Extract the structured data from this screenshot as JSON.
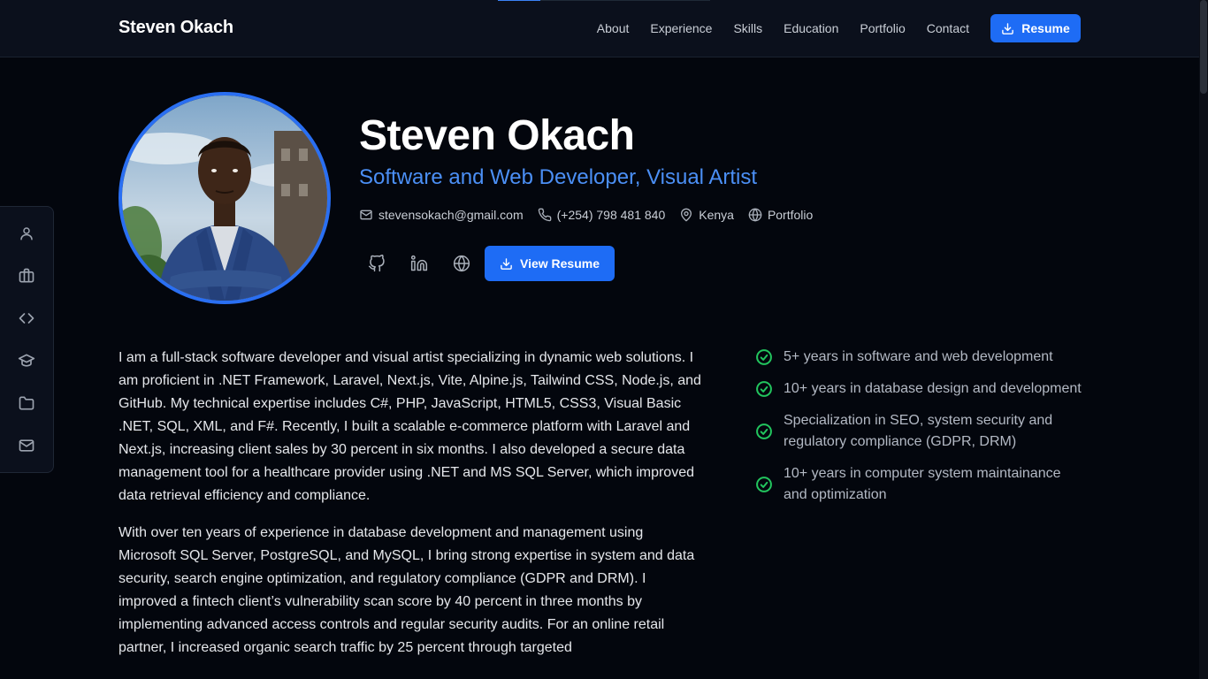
{
  "navbar": {
    "brand": "Steven Okach",
    "links": [
      "About",
      "Experience",
      "Skills",
      "Education",
      "Portfolio",
      "Contact"
    ],
    "resume_label": "Resume",
    "scroll_progress": 0.2
  },
  "side_nav": {
    "icons": [
      "user-icon",
      "briefcase-icon",
      "code-icon",
      "graduation-cap-icon",
      "folder-icon",
      "mail-icon"
    ]
  },
  "hero": {
    "name": "Steven Okach",
    "title": "Software and Web Developer, Visual Artist",
    "email": "stevensokach@gmail.com",
    "phone": "(+254) 798 481 840",
    "location": "Kenya",
    "website": "Portfolio",
    "view_resume_label": "View Resume"
  },
  "about": {
    "paragraphs": [
      "I am a full-stack software developer and visual artist specializing in dynamic web solutions. I am proficient in .NET Framework, Laravel, Next.js, Vite, Alpine.js, Tailwind CSS, Node.js, and GitHub. My technical expertise includes C#, PHP, JavaScript, HTML5, CSS3, Visual Basic .NET, SQL, XML, and F#. Recently, I built a scalable e-commerce platform with Laravel and Next.js, increasing client sales by 30 percent in six months. I also developed a secure data management tool for a healthcare provider using .NET and MS SQL Server, which improved data retrieval efficiency and compliance.",
      "With over ten years of experience in database development and management using Microsoft SQL Server, PostgreSQL, and MySQL, I bring strong expertise in system and data security, search engine optimization, and regulatory compliance (GDPR and DRM). I improved a fintech client’s vulnerability scan score by 40 percent in three months by implementing advanced access controls and regular security audits. For an online retail partner, I increased organic search traffic by 25 percent through targeted"
    ]
  },
  "highlights": [
    "5+ years in software and web development",
    "10+ years in database design and development",
    "Specialization in SEO, system security and regulatory compliance (GDPR, DRM)",
    "10+ years in computer system maintainance and optimization"
  ],
  "colors": {
    "accent": "#1e6cf5",
    "title_blue": "#4b8ff5",
    "check_green": "#22c55e",
    "background": "#03060d"
  }
}
